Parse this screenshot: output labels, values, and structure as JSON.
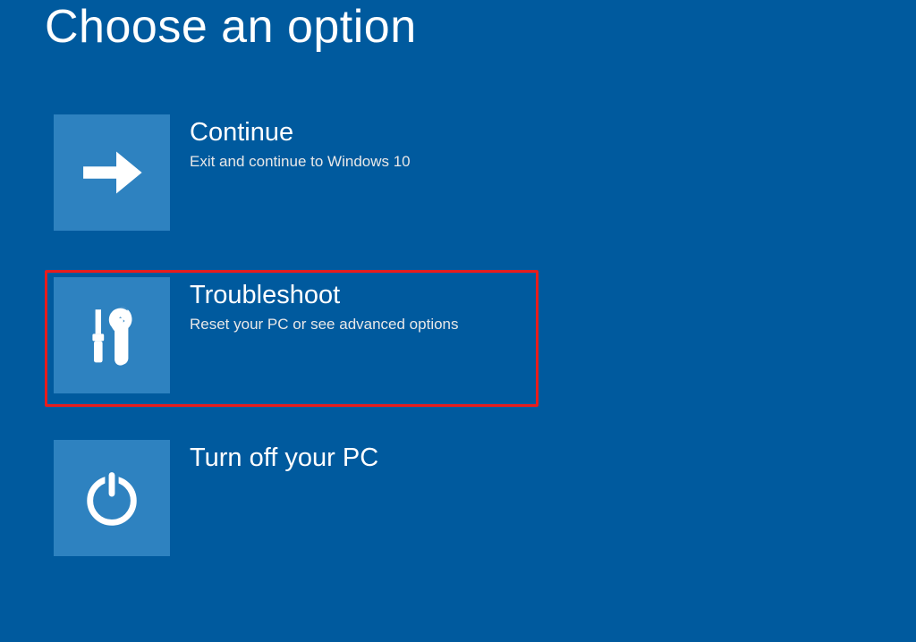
{
  "title": "Choose an option",
  "options": [
    {
      "title": "Continue",
      "desc": "Exit and continue to Windows 10"
    },
    {
      "title": "Troubleshoot",
      "desc": "Reset your PC or see advanced options"
    },
    {
      "title": "Turn off your PC",
      "desc": ""
    }
  ]
}
